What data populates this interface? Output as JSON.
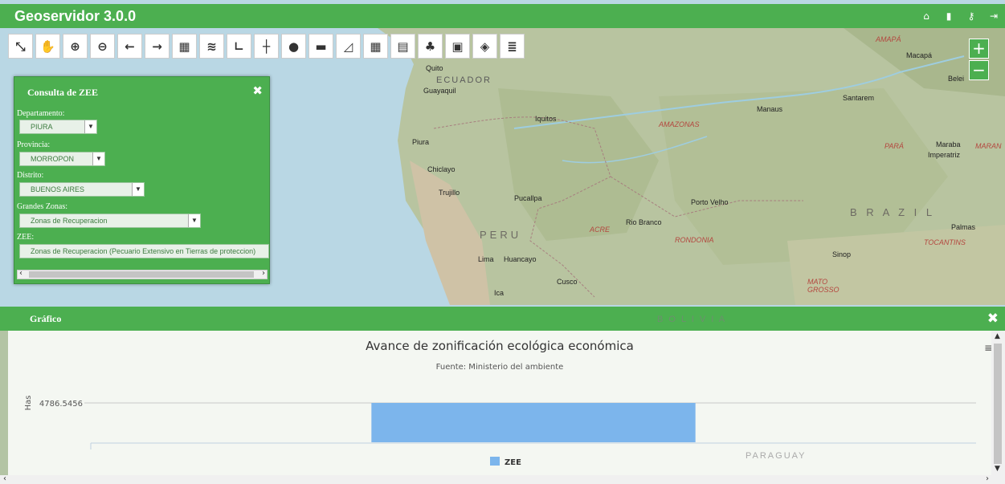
{
  "app": {
    "title": "Geoservidor 3.0.0"
  },
  "top_icons": [
    "home-icon",
    "book-icon",
    "key-icon",
    "logout-icon"
  ],
  "toolbar": [
    {
      "name": "full-extent-icon",
      "glyph": "⤡"
    },
    {
      "name": "pan-hand-icon",
      "glyph": "✋"
    },
    {
      "name": "zoom-in-icon",
      "glyph": "⊕"
    },
    {
      "name": "zoom-out-icon",
      "glyph": "⊖"
    },
    {
      "name": "back-arrow-icon",
      "glyph": "←"
    },
    {
      "name": "forward-arrow-icon",
      "glyph": "→"
    },
    {
      "name": "map-catalog-icon",
      "glyph": "▦"
    },
    {
      "name": "layers-icon",
      "glyph": "≋"
    },
    {
      "name": "measure-distance-icon",
      "glyph": "∟"
    },
    {
      "name": "coordinates-icon",
      "glyph": "┼"
    },
    {
      "name": "info-icon",
      "glyph": "●"
    },
    {
      "name": "print-icon",
      "glyph": "▬"
    },
    {
      "name": "area-chart-icon",
      "glyph": "◿"
    },
    {
      "name": "grid-table-icon",
      "glyph": "▦"
    },
    {
      "name": "table-edit-icon",
      "glyph": "▤"
    },
    {
      "name": "tree-icon",
      "glyph": "♣"
    },
    {
      "name": "lock-document-icon",
      "glyph": "▣"
    },
    {
      "name": "map-marker-icon",
      "glyph": "◈"
    },
    {
      "name": "layer-stack-icon",
      "glyph": "≣"
    }
  ],
  "zoom": {
    "in": "+",
    "out": "−"
  },
  "map_labels": {
    "quito": "Quito",
    "ecuador": "ECUADOR",
    "guayaquil": "Guayaquil",
    "iquitos": "Iquitos",
    "piura": "Piura",
    "chiclayo": "Chiclayo",
    "trujillo": "Trujillo",
    "pucallpa": "Pucallpa",
    "peru": "PERU",
    "lima": "Lima",
    "huancayo": "Huancayo",
    "cusco": "Cusco",
    "ica": "Ica",
    "acre": "ACRE",
    "rio_branco": "Rio Branco",
    "rondonia": "RONDONIA",
    "porto_velho": "Porto Velho",
    "amazonas": "AMAZONAS",
    "manaus": "Manaus",
    "santarem": "Santarem",
    "para": "PARÁ",
    "maraba": "Maraba",
    "imperatriz": "Imperatriz",
    "maran": "MARAN",
    "belem": "Belei",
    "macapa": "Macapá",
    "amapa": "AMAPÁ",
    "brazil": "B R A Z I L",
    "palmas": "Palmas",
    "tocantins": "TOCANTINS",
    "sinop": "Sinop",
    "mato_grosso": "MATO GROSSO",
    "bolivia": "B O L I V I A",
    "paraguay": "PARAGUAY"
  },
  "zee_panel": {
    "title": "Consulta de ZEE",
    "fields": [
      {
        "label": "Departamento:",
        "value": "PIURA"
      },
      {
        "label": "Provincia:",
        "value": "MORROPON"
      },
      {
        "label": "Distrito:",
        "value": "BUENOS AIRES"
      },
      {
        "label": "Grandes Zonas:",
        "value": "Zonas de Recuperacion"
      },
      {
        "label": "ZEE:",
        "value": "Zonas de Recuperacion (Pecuario Extensivo en Tierras de proteccion)"
      }
    ]
  },
  "chart_panel": {
    "title": "Gráfico"
  },
  "chart_data": {
    "type": "bar",
    "title": "Avance de zonificación ecológica económica",
    "subtitle": "Fuente: Ministerio del ambiente",
    "ylabel": "Has",
    "categories": [
      ""
    ],
    "series": [
      {
        "name": "ZEE",
        "values": [
          4786.5456
        ]
      }
    ],
    "y_tick_labels": [
      "4786.5456"
    ],
    "legend": "bottom-center",
    "grid": true,
    "colors": {
      "ZEE": "#7cb5ec"
    }
  }
}
